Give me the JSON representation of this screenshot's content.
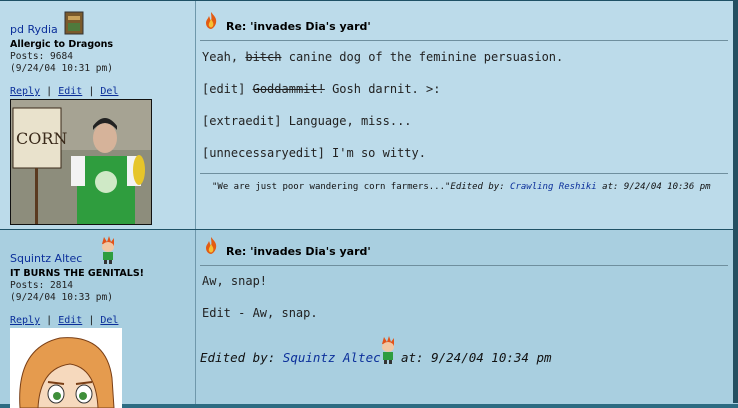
{
  "posts": [
    {
      "author": {
        "name": "pd Rydia",
        "title": "Allergic to Dragons",
        "posts": "Posts: 9684",
        "date": "(9/24/04 10:31 pm)"
      },
      "actions": {
        "reply": "Reply",
        "edit": "Edit",
        "del": "Del",
        "sep": "|"
      },
      "subject": "Re: 'invades Dia's yard'",
      "body": {
        "line1_prefix": "Yeah,",
        "line1_struck": "bitch",
        "line1_suffix": "canine dog of the feminine persuasion.",
        "line2_prefix": "[edit]",
        "line2_struck": "Goddammit!",
        "line2_suffix": "Gosh darnit. >:",
        "line3": "[extraedit] Language, miss...",
        "line4": "[unnecessaryedit] I'm so witty."
      },
      "signature": {
        "quote": "\"We are just poor wandering corn farmers...\"",
        "edited_by": "Edited by:",
        "editor": "Crawling Reshiki",
        "at": "at: 9/24/04 10:36 pm"
      },
      "avatar_text": "CORN"
    },
    {
      "author": {
        "name": "Squintz Altec",
        "title": "IT BURNS THE GENITALS!",
        "posts": "Posts: 2814",
        "date": "(9/24/04 10:33 pm)"
      },
      "actions": {
        "reply": "Reply",
        "edit": "Edit",
        "del": "Del",
        "sep": "|"
      },
      "subject": "Re: 'invades Dia's yard'",
      "body": {
        "line1": "Aw, snap!",
        "line2": "Edit - Aw, snap."
      },
      "edit": {
        "edited_by": "Edited by:",
        "editor": "Squintz Altec",
        "at": "at: 9/24/04 10:34 pm"
      }
    }
  ],
  "colors": {
    "post1_bg": "#bcdbea",
    "post2_bg": "#a9cfe0",
    "link": "#0b2f9a",
    "frame": "#2d6b82"
  }
}
